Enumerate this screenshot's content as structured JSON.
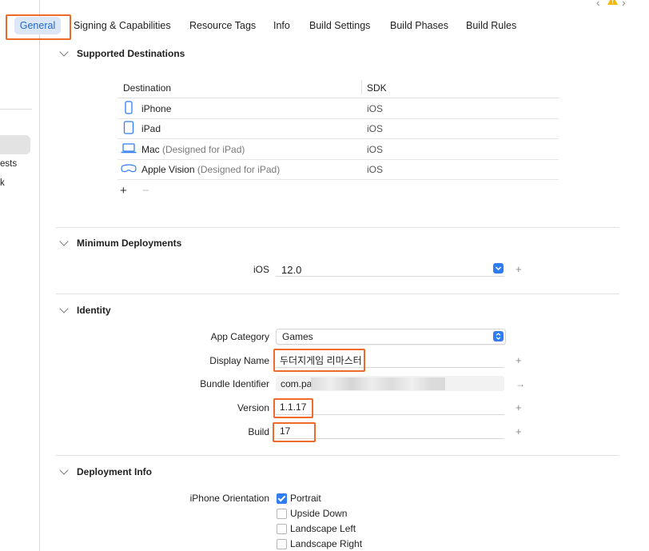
{
  "tabs": [
    {
      "label": "General"
    },
    {
      "label": "Signing & Capabilities"
    },
    {
      "label": "Resource Tags"
    },
    {
      "label": "Info"
    },
    {
      "label": "Build Settings"
    },
    {
      "label": "Build Phases"
    },
    {
      "label": "Build Rules"
    }
  ],
  "sidebar": {
    "fragments": [
      "ests",
      "k"
    ]
  },
  "sections": {
    "supported_destinations": {
      "title": "Supported Destinations",
      "columns": [
        "Destination",
        "SDK"
      ],
      "rows": [
        {
          "name": "iPhone",
          "sub": "",
          "sdk": "iOS",
          "icon": "iphone-icon"
        },
        {
          "name": "iPad",
          "sub": "",
          "sdk": "iOS",
          "icon": "ipad-icon"
        },
        {
          "name": "Mac",
          "sub": "(Designed for iPad)",
          "sdk": "iOS",
          "icon": "mac-icon"
        },
        {
          "name": "Apple Vision",
          "sub": "(Designed for iPad)",
          "sdk": "iOS",
          "icon": "vision-pro-icon"
        }
      ],
      "add": "+",
      "remove": "−"
    },
    "minimum_deployments": {
      "title": "Minimum Deployments",
      "ios_label": "iOS",
      "ios_value": "12.0"
    },
    "identity": {
      "title": "Identity",
      "app_category_label": "App Category",
      "app_category_value": "Games",
      "display_name_label": "Display Name",
      "display_name_value": "두더지게임 리마스터",
      "bundle_id_label": "Bundle Identifier",
      "bundle_id_value": "com.pa",
      "version_label": "Version",
      "version_value": "1.1.17",
      "build_label": "Build",
      "build_value": "17"
    },
    "deployment_info": {
      "title": "Deployment Info",
      "orientation_label": "iPhone Orientation",
      "orientations": [
        {
          "label": "Portrait",
          "checked": true
        },
        {
          "label": "Upside Down",
          "checked": false
        },
        {
          "label": "Landscape Left",
          "checked": false
        },
        {
          "label": "Landscape Right",
          "checked": false
        }
      ]
    }
  },
  "colors": {
    "accent": "#2f7cf6",
    "highlight": "#f06a2a",
    "selected_tab_bg": "#dbe7f7",
    "selected_tab_text": "#2468c7"
  }
}
